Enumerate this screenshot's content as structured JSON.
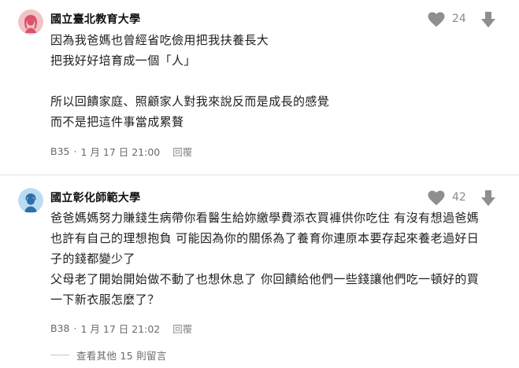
{
  "comments": [
    {
      "author": "國立臺北教育大學",
      "likes": "24",
      "body": "因為我爸媽也曾經省吃儉用把我扶養長大\n把我好好培育成一個「人」\n\n所以回饋家庭、照顧家人對我來說反而是成長的感覺\n而不是把這件事當成累贅",
      "floor": "B35",
      "date": "1 月 17 日 21:00",
      "reply_label": "回覆",
      "avatar_icon": "female-avatar-icon",
      "avatar_color": "#f2c2c5"
    },
    {
      "author": "國立彰化師範大學",
      "likes": "42",
      "body": "爸爸媽媽努力賺錢生病帶你看醫生給妳繳學費添衣買褲供你吃住 有沒有想過爸媽\n也許有自己的理想抱負 可能因為你的關係為了養育你連原本要存起來養老過好日\n子的錢都變少了\n父母老了開始開始做不動了也想休息了 你回饋給他們一些錢讓他們吃一頓好的買\n一下新衣服怎麼了？",
      "floor": "B38",
      "date": "1 月 17 日 21:02",
      "reply_label": "回覆",
      "avatar_icon": "male-avatar-icon",
      "avatar_color": "#b9dcf3"
    }
  ],
  "more_replies": "查看其他 15 則留言",
  "meta_separator": "·",
  "colors": {
    "icon_gray": "#8f8f8f",
    "text": "#1e1e1e",
    "meta": "#6a6a6a"
  }
}
